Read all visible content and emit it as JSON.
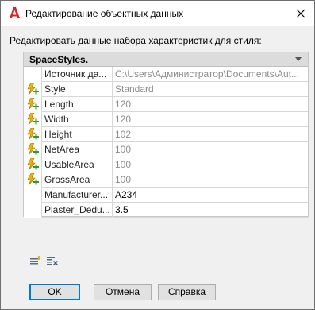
{
  "window": {
    "title": "Редактирование объектных данных",
    "icon": "autocad-a-icon"
  },
  "prompt": "Редактировать данные набора характеристик для стиля:",
  "grid": {
    "header": "SpaceStyles.",
    "rows": [
      {
        "name": "Источник да...",
        "value": "C:\\Users\\Администратор\\Documents\\Aut...",
        "icon": null,
        "editable": false
      },
      {
        "name": "Style",
        "value": "Standard",
        "icon": "auto-property-icon",
        "editable": false
      },
      {
        "name": "Length",
        "value": "120",
        "icon": "auto-property-icon",
        "editable": false
      },
      {
        "name": "Width",
        "value": "120",
        "icon": "auto-property-icon",
        "editable": false
      },
      {
        "name": "Height",
        "value": "102",
        "icon": "auto-property-icon",
        "editable": false
      },
      {
        "name": "NetArea",
        "value": "100",
        "icon": "auto-property-icon",
        "editable": false
      },
      {
        "name": "UsableArea",
        "value": "100",
        "icon": "auto-property-icon",
        "editable": false
      },
      {
        "name": "GrossArea",
        "value": "100",
        "icon": "auto-property-icon",
        "editable": false
      },
      {
        "name": "Manufacturer...",
        "value": "A234",
        "icon": null,
        "editable": true
      },
      {
        "name": "Plaster_Dedu...",
        "value": "3.5",
        "icon": null,
        "editable": true
      }
    ]
  },
  "toolbar": {
    "add_icon": "add-property-set-icon",
    "remove_icon": "remove-property-set-icon"
  },
  "buttons": {
    "ok": "OK",
    "cancel": "Отмена",
    "help": "Справка"
  },
  "colors": {
    "accent": "#0078d7",
    "brand_red": "#d6232a",
    "bolt_yellow": "#f0b400",
    "plus_green": "#2e9b2e"
  }
}
